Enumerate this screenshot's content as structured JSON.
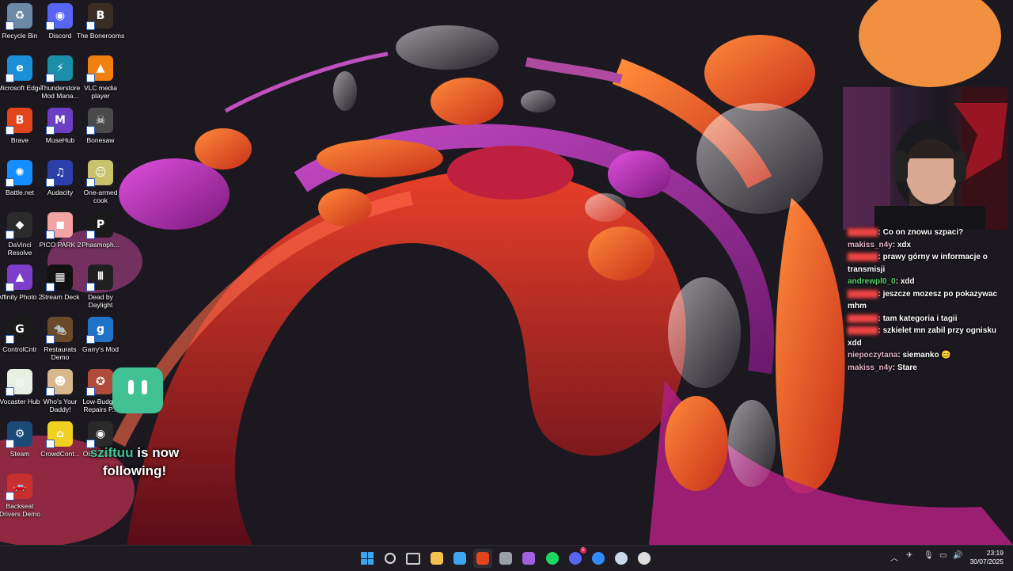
{
  "desktop": {
    "icons": [
      {
        "label": "Recycle Bin",
        "glyph": "♻",
        "color": "#6a8aa8",
        "icon": "recycle-bin-icon"
      },
      {
        "label": "Discord",
        "glyph": "◉",
        "color": "#5865f2",
        "icon": "discord-icon"
      },
      {
        "label": "The Bonerooms",
        "glyph": "B",
        "color": "#3a2e24",
        "icon": "bonerooms-icon"
      },
      {
        "label": "Microsoft Edge",
        "glyph": "e",
        "color": "#1a8fd8",
        "icon": "edge-icon"
      },
      {
        "label": "Thunderstore Mod Mana...",
        "glyph": "⚡",
        "color": "#1b8ea8",
        "icon": "thunderstore-icon"
      },
      {
        "label": "VLC media player",
        "glyph": "▲",
        "color": "#f08010",
        "icon": "vlc-icon"
      },
      {
        "label": "Brave",
        "glyph": "B",
        "color": "#e2451c",
        "icon": "brave-icon"
      },
      {
        "label": "MuseHub",
        "glyph": "M",
        "color": "#6c3ec4",
        "icon": "musehub-icon"
      },
      {
        "label": "Bonesaw",
        "glyph": "☠",
        "color": "#4a4a4a",
        "icon": "bonesaw-icon"
      },
      {
        "label": "Battle.net",
        "glyph": "✺",
        "color": "#148eff",
        "icon": "battlenet-icon"
      },
      {
        "label": "Audacity",
        "glyph": "♫",
        "color": "#2c3fa8",
        "icon": "audacity-icon"
      },
      {
        "label": "One-armed cook",
        "glyph": "☺",
        "color": "#c9c26c",
        "icon": "one-armed-cook-icon"
      },
      {
        "label": "DaVinci Resolve",
        "glyph": "◆",
        "color": "#2b2b2b",
        "icon": "davinci-icon"
      },
      {
        "label": "PICO PARK 2",
        "glyph": "◼",
        "color": "#f4a3a3",
        "icon": "pico-park-icon"
      },
      {
        "label": "Phasmoph...",
        "glyph": "P",
        "color": "#1a1a1a",
        "icon": "phasmophobia-icon"
      },
      {
        "label": "Affinity Photo 2",
        "glyph": "▲",
        "color": "#7e3ec9",
        "icon": "affinity-photo-icon"
      },
      {
        "label": "Stream Deck",
        "glyph": "▦",
        "color": "#111111",
        "icon": "stream-deck-icon"
      },
      {
        "label": "Dead by Daylight",
        "glyph": "𝍫",
        "color": "#202020",
        "icon": "dead-by-daylight-icon"
      },
      {
        "label": "ControlCntr",
        "glyph": "G",
        "color": "#1b1b1b",
        "icon": "controlcntr-icon"
      },
      {
        "label": "Restaurats Demo",
        "glyph": "🐀",
        "color": "#6a4a2a",
        "icon": "restaurats-icon"
      },
      {
        "label": "Garry's Mod",
        "glyph": "g",
        "color": "#1f74c8",
        "icon": "garrys-mod-icon"
      },
      {
        "label": "Vocaster Hub",
        "glyph": "◎",
        "color": "#e8f0e4",
        "icon": "vocaster-hub-icon"
      },
      {
        "label": "Who's Your Daddy!",
        "glyph": "☻",
        "color": "#d8b88a",
        "icon": "whos-your-daddy-icon"
      },
      {
        "label": "Low-Budget Repairs P...",
        "glyph": "✪",
        "color": "#b04a3a",
        "icon": "low-budget-repairs-icon"
      },
      {
        "label": "Steam",
        "glyph": "⚙",
        "color": "#1b4a78",
        "icon": "steam-icon"
      },
      {
        "label": "CrowdCont...",
        "glyph": "⌂",
        "color": "#f0d020",
        "icon": "crowdcontrol-icon"
      },
      {
        "label": "OBS Studio",
        "glyph": "◉",
        "color": "#2a2a2a",
        "icon": "obs-studio-icon"
      },
      {
        "label": "Backseat Drivers Demo",
        "glyph": "🚗",
        "color": "#c83030",
        "icon": "backseat-drivers-icon"
      }
    ]
  },
  "chat": {
    "messages": [
      {
        "user": "",
        "text": "Co on znowu szpaci?",
        "style": "blur"
      },
      {
        "user": "makiss_n4y",
        "text": "xdx",
        "style": "pink"
      },
      {
        "user": "",
        "text": "prawy górny w informacje o transmisji",
        "style": "blur"
      },
      {
        "user": "andrewpl0_0",
        "text": "xdd",
        "style": "green"
      },
      {
        "user": "",
        "text": "jeszcze mozesz po pokazywac mhm",
        "style": "blur"
      },
      {
        "user": "",
        "text": "tam kategoria i tagii",
        "style": "blur"
      },
      {
        "user": "",
        "text": "szkielet mn zabil przy ognisku xdd",
        "style": "blur"
      },
      {
        "user": "niepoczytana",
        "text": "siemanko 😊",
        "style": "pink"
      },
      {
        "user": "makiss_n4y",
        "text": "Stare",
        "style": "pink"
      }
    ]
  },
  "alert": {
    "username": "sziftuu",
    "line1_rest": " is now",
    "line2": "following!"
  },
  "taskbar": {
    "apps": [
      {
        "name": "start",
        "color": "#3fa4f0"
      },
      {
        "name": "search",
        "color": "#dddddd"
      },
      {
        "name": "task-view",
        "color": "#cccccc"
      },
      {
        "name": "file-explorer",
        "color": "#f2c14e"
      },
      {
        "name": "microsoft-store",
        "color": "#3fa4f0"
      },
      {
        "name": "brave",
        "color": "#e2451c"
      },
      {
        "name": "davinci-resolve",
        "color": "#9aa0a8"
      },
      {
        "name": "affinity-photo",
        "color": "#a060e0"
      },
      {
        "name": "spotify",
        "color": "#1ed760"
      },
      {
        "name": "discord",
        "color": "#5865f2"
      },
      {
        "name": "messenger",
        "color": "#2f8cff"
      },
      {
        "name": "steam",
        "color": "#c8d8e8"
      },
      {
        "name": "obs-studio",
        "color": "#dddddd"
      }
    ],
    "discord_badge": "5",
    "time": "23:19",
    "date": "30/07/2025"
  }
}
